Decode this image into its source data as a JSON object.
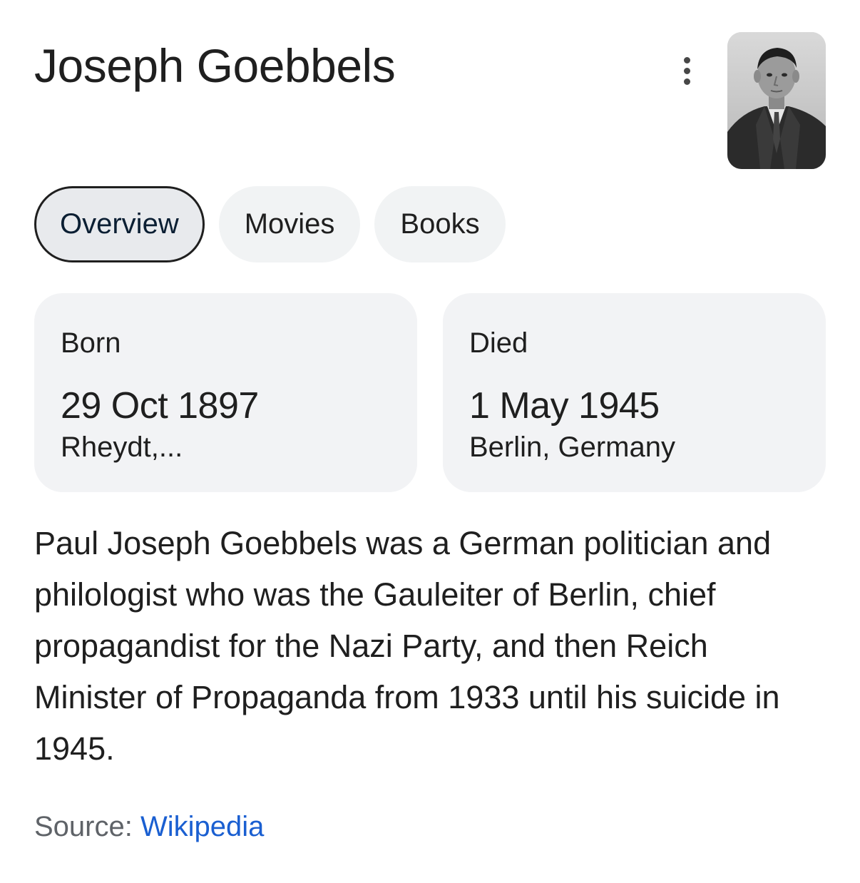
{
  "title": "Joseph Goebbels",
  "icons": {
    "more": "more-vert-icon"
  },
  "image": {
    "alt": "Portrait photograph"
  },
  "tabs": [
    {
      "label": "Overview",
      "active": true
    },
    {
      "label": "Movies",
      "active": false
    },
    {
      "label": "Books",
      "active": false
    }
  ],
  "born": {
    "label": "Born",
    "date": "29 Oct 1897",
    "place": "Rheydt,..."
  },
  "died": {
    "label": "Died",
    "date": "1 May 1945",
    "place": "Berlin, Germany"
  },
  "description": "Paul Joseph Goebbels was a German politician and philologist who was the Gauleiter of Berlin, chief propagandist for the Nazi Party, and then Reich Minister of Propaganda from 1933 until his suicide in 1945.",
  "source": {
    "prefix": "Source:",
    "link": "Wikipedia"
  },
  "colors": {
    "link": "#1a5fd1",
    "chip_bg": "#f1f3f4",
    "card_bg": "#f2f3f5",
    "text": "#1f1f1f",
    "muted": "#5f6368"
  }
}
